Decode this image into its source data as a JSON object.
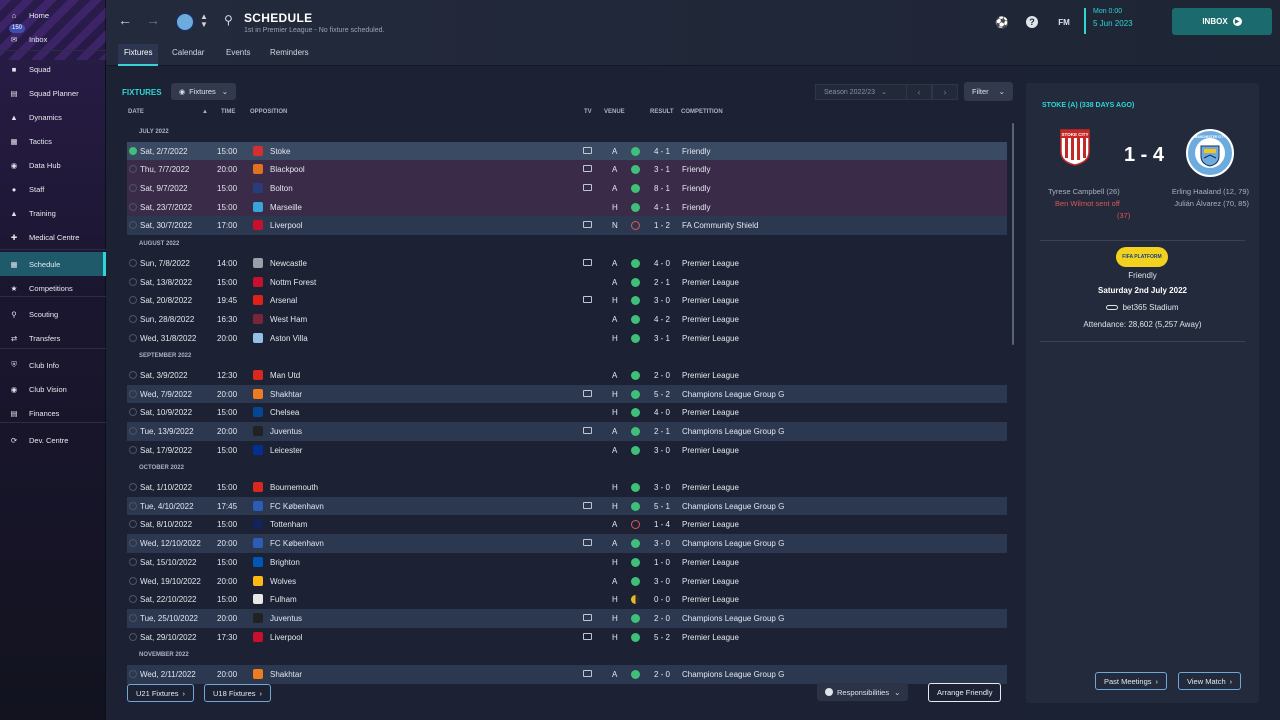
{
  "sidebar": {
    "items": [
      {
        "label": "Home",
        "icon": "home-icon"
      },
      {
        "label": "Inbox",
        "icon": "inbox-icon",
        "badge": "150"
      },
      {
        "label": "Squad",
        "icon": "shirt-icon"
      },
      {
        "label": "Squad Planner",
        "icon": "clipboard-icon"
      },
      {
        "label": "Dynamics",
        "icon": "dynamics-icon"
      },
      {
        "label": "Tactics",
        "icon": "tactics-board-icon"
      },
      {
        "label": "Data Hub",
        "icon": "data-hub-icon"
      },
      {
        "label": "Staff",
        "icon": "staff-icon"
      },
      {
        "label": "Training",
        "icon": "training-icon"
      },
      {
        "label": "Medical Centre",
        "icon": "medical-icon"
      },
      {
        "label": "Schedule",
        "icon": "calendar-icon"
      },
      {
        "label": "Competitions",
        "icon": "trophy-icon"
      },
      {
        "label": "Scouting",
        "icon": "scouting-icon"
      },
      {
        "label": "Transfers",
        "icon": "transfers-icon"
      },
      {
        "label": "Club Info",
        "icon": "shield-icon"
      },
      {
        "label": "Club Vision",
        "icon": "vision-icon"
      },
      {
        "label": "Finances",
        "icon": "finances-icon"
      },
      {
        "label": "Dev. Centre",
        "icon": "dev-centre-icon"
      }
    ]
  },
  "header": {
    "title": "SCHEDULE",
    "subtitle": "1st in Premier League - No fixture scheduled.",
    "tabs": [
      "Fixtures",
      "Calendar",
      "Events",
      "Reminders"
    ],
    "fm_label": "FM",
    "date_day": "Mon 0:00",
    "date_date": "5 Jun 2023",
    "inbox_label": "INBOX"
  },
  "main": {
    "fixtures_label": "FIXTURES",
    "fixtures_dropdown": "Fixtures",
    "season": "Season 2022/23",
    "filter_label": "Filter",
    "columns": {
      "date": "DATE",
      "time": "TIME",
      "opposition": "OPPOSITION",
      "tv": "TV",
      "venue": "VENUE",
      "result": "RESULT",
      "competition": "COMPETITION"
    },
    "groups": [
      {
        "month": "JULY 2022",
        "rows": [
          {
            "date": "Sat, 2/7/2022",
            "time": "15:00",
            "opp": "Stoke",
            "tv": true,
            "venue": "A",
            "result": "4 - 1",
            "outcome": "win",
            "comp": "Friendly",
            "bg": "sel",
            "crest": "#d32f2f"
          },
          {
            "date": "Thu, 7/7/2022",
            "time": "20:00",
            "opp": "Blackpool",
            "tv": true,
            "venue": "A",
            "result": "3 - 1",
            "outcome": "win",
            "comp": "Friendly",
            "bg": "purple",
            "crest": "#e0711f"
          },
          {
            "date": "Sat, 9/7/2022",
            "time": "15:00",
            "opp": "Bolton",
            "tv": true,
            "venue": "A",
            "result": "8 - 1",
            "outcome": "win",
            "comp": "Friendly",
            "bg": "purple",
            "crest": "#2a3b7a"
          },
          {
            "date": "Sat, 23/7/2022",
            "time": "15:00",
            "opp": "Marseille",
            "tv": false,
            "venue": "H",
            "result": "4 - 1",
            "outcome": "win",
            "comp": "Friendly",
            "bg": "purple",
            "crest": "#39a3dc"
          },
          {
            "date": "Sat, 30/7/2022",
            "time": "17:00",
            "opp": "Liverpool",
            "tv": true,
            "venue": "N",
            "result": "1 - 2",
            "outcome": "loss",
            "comp": "FA Community Shield",
            "bg": "blue",
            "crest": "#c8102e"
          }
        ]
      },
      {
        "month": "AUGUST 2022",
        "rows": [
          {
            "date": "Sun, 7/8/2022",
            "time": "14:00",
            "opp": "Newcastle",
            "tv": true,
            "venue": "A",
            "result": "4 - 0",
            "outcome": "win",
            "comp": "Premier League",
            "bg": "none",
            "crest": "#9aa0a8"
          },
          {
            "date": "Sat, 13/8/2022",
            "time": "15:00",
            "opp": "Nottm Forest",
            "tv": false,
            "venue": "A",
            "result": "2 - 1",
            "outcome": "win",
            "comp": "Premier League",
            "bg": "none",
            "crest": "#c8102e"
          },
          {
            "date": "Sat, 20/8/2022",
            "time": "19:45",
            "opp": "Arsenal",
            "tv": true,
            "venue": "H",
            "result": "3 - 0",
            "outcome": "win",
            "comp": "Premier League",
            "bg": "none",
            "crest": "#e0201b"
          },
          {
            "date": "Sun, 28/8/2022",
            "time": "16:30",
            "opp": "West Ham",
            "tv": false,
            "venue": "A",
            "result": "4 - 2",
            "outcome": "win",
            "comp": "Premier League",
            "bg": "none",
            "crest": "#7a263a"
          },
          {
            "date": "Wed, 31/8/2022",
            "time": "20:00",
            "opp": "Aston Villa",
            "tv": false,
            "venue": "H",
            "result": "3 - 1",
            "outcome": "win",
            "comp": "Premier League",
            "bg": "none",
            "crest": "#95bfe5"
          }
        ]
      },
      {
        "month": "SEPTEMBER 2022",
        "rows": [
          {
            "date": "Sat, 3/9/2022",
            "time": "12:30",
            "opp": "Man Utd",
            "tv": false,
            "venue": "A",
            "result": "2 - 0",
            "outcome": "win",
            "comp": "Premier League",
            "bg": "none",
            "crest": "#da291c"
          },
          {
            "date": "Wed, 7/9/2022",
            "time": "20:00",
            "opp": "Shakhtar",
            "tv": true,
            "venue": "H",
            "result": "5 - 2",
            "outcome": "win",
            "comp": "Champions League Group G",
            "bg": "blue",
            "crest": "#f07b1f"
          },
          {
            "date": "Sat, 10/9/2022",
            "time": "15:00",
            "opp": "Chelsea",
            "tv": false,
            "venue": "H",
            "result": "4 - 0",
            "outcome": "win",
            "comp": "Premier League",
            "bg": "none",
            "crest": "#034694"
          },
          {
            "date": "Tue, 13/9/2022",
            "time": "20:00",
            "opp": "Juventus",
            "tv": true,
            "venue": "A",
            "result": "2 - 1",
            "outcome": "win",
            "comp": "Champions League Group G",
            "bg": "blue",
            "crest": "#222222"
          },
          {
            "date": "Sat, 17/9/2022",
            "time": "15:00",
            "opp": "Leicester",
            "tv": false,
            "venue": "A",
            "result": "3 - 0",
            "outcome": "win",
            "comp": "Premier League",
            "bg": "none",
            "crest": "#003090"
          }
        ]
      },
      {
        "month": "OCTOBER 2022",
        "rows": [
          {
            "date": "Sat, 1/10/2022",
            "time": "15:00",
            "opp": "Bournemouth",
            "tv": false,
            "venue": "H",
            "result": "3 - 0",
            "outcome": "win",
            "comp": "Premier League",
            "bg": "none",
            "crest": "#da291c"
          },
          {
            "date": "Tue, 4/10/2022",
            "time": "17:45",
            "opp": "FC København",
            "tv": true,
            "venue": "H",
            "result": "5 - 1",
            "outcome": "win",
            "comp": "Champions League Group G",
            "bg": "blue",
            "crest": "#2b5db4"
          },
          {
            "date": "Sat, 8/10/2022",
            "time": "15:00",
            "opp": "Tottenham",
            "tv": false,
            "venue": "A",
            "result": "1 - 4",
            "outcome": "loss",
            "comp": "Premier League",
            "bg": "none",
            "crest": "#132257"
          },
          {
            "date": "Wed, 12/10/2022",
            "time": "20:00",
            "opp": "FC København",
            "tv": true,
            "venue": "A",
            "result": "3 - 0",
            "outcome": "win",
            "comp": "Champions League Group G",
            "bg": "blue",
            "crest": "#2b5db4"
          },
          {
            "date": "Sat, 15/10/2022",
            "time": "15:00",
            "opp": "Brighton",
            "tv": false,
            "venue": "H",
            "result": "1 - 0",
            "outcome": "win",
            "comp": "Premier League",
            "bg": "none",
            "crest": "#0057b8"
          },
          {
            "date": "Wed, 19/10/2022",
            "time": "20:00",
            "opp": "Wolves",
            "tv": false,
            "venue": "A",
            "result": "3 - 0",
            "outcome": "win",
            "comp": "Premier League",
            "bg": "none",
            "crest": "#fdb913"
          },
          {
            "date": "Sat, 22/10/2022",
            "time": "15:00",
            "opp": "Fulham",
            "tv": false,
            "venue": "H",
            "result": "0 - 0",
            "outcome": "draw",
            "comp": "Premier League",
            "bg": "none",
            "crest": "#e8e8e8"
          },
          {
            "date": "Tue, 25/10/2022",
            "time": "20:00",
            "opp": "Juventus",
            "tv": true,
            "venue": "H",
            "result": "2 - 0",
            "outcome": "win",
            "comp": "Champions League Group G",
            "bg": "blue",
            "crest": "#222222"
          },
          {
            "date": "Sat, 29/10/2022",
            "time": "17:30",
            "opp": "Liverpool",
            "tv": true,
            "venue": "H",
            "result": "5 - 2",
            "outcome": "win",
            "comp": "Premier League",
            "bg": "none",
            "crest": "#c8102e"
          }
        ]
      },
      {
        "month": "NOVEMBER 2022",
        "rows": [
          {
            "date": "Wed, 2/11/2022",
            "time": "20:00",
            "opp": "Shakhtar",
            "tv": true,
            "venue": "A",
            "result": "2 - 0",
            "outcome": "win",
            "comp": "Champions League Group G",
            "bg": "blue",
            "crest": "#f07b1f"
          }
        ]
      }
    ],
    "footer": {
      "u21": "U21 Fixtures",
      "u18": "U18 Fixtures",
      "responsibilities": "Responsibilities",
      "arrange": "Arrange Friendly"
    }
  },
  "match": {
    "header": "STOKE (A) (338 DAYS AGO)",
    "home_crest_text": "STOKE CITY",
    "away_crest_text": "MANCHESTER CITY",
    "score": "1 - 4",
    "home_scorers": [
      "Tyrese Campbell (26)"
    ],
    "home_red": "Ben Wilmot sent off",
    "home_red_min": "(37)",
    "away_scorers": [
      "Erling Haaland (12, 79)",
      "Julián Álvarez (70, 85)"
    ],
    "competition": "Friendly",
    "badge_text": "FIFA PLATFORM",
    "date": "Saturday 2nd July 2022",
    "stadium": "bet365 Stadium",
    "attendance": "Attendance: 28,602 (5,257 Away)",
    "past_meetings": "Past Meetings",
    "view_match": "View Match"
  },
  "colors": {
    "accent": "#2fd6d6",
    "win": "#3fbf7a",
    "draw": "#e8b923",
    "loss": "#e25555"
  }
}
